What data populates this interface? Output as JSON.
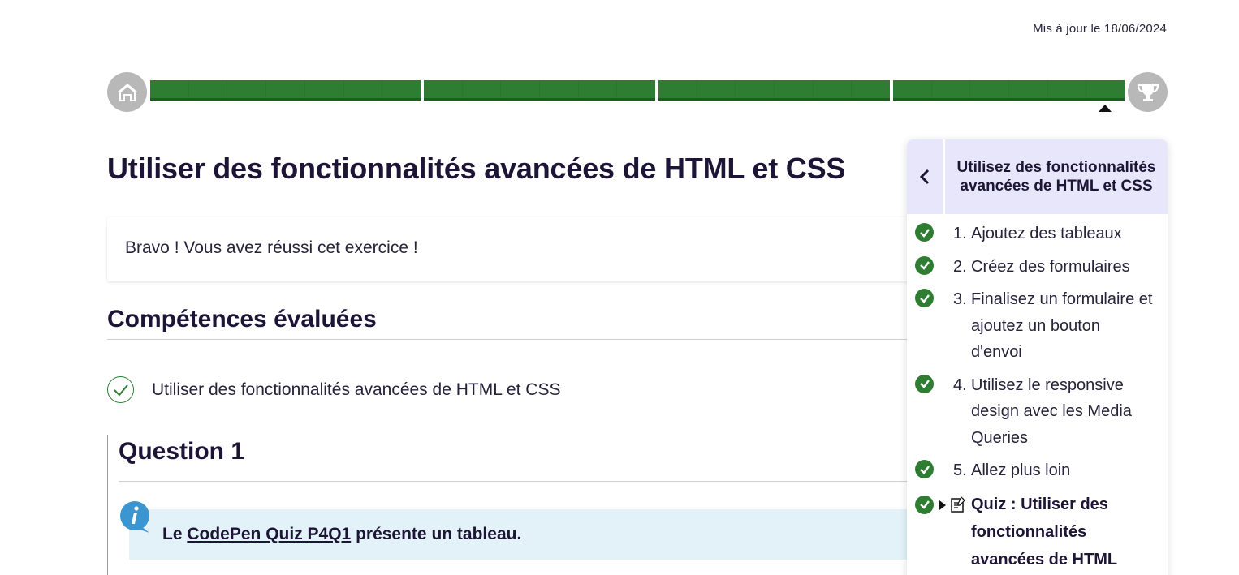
{
  "updated": "Mis à jour le 18/06/2024",
  "progress": {
    "segments": [
      7,
      6,
      6,
      6
    ],
    "marker_position": 0.97,
    "fill_color": "#2e7d32"
  },
  "title": "Utiliser des fonctionnalités avancées de HTML et CSS",
  "success_message": "Bravo ! Vous avez réussi cet exercice !",
  "skills": {
    "heading": "Compétences évaluées",
    "items": [
      "Utiliser des fonctionnalités avancées de HTML et CSS"
    ]
  },
  "question": {
    "heading": "Question 1",
    "info_prefix": "Le ",
    "info_link": "CodePen Quiz P4Q1",
    "info_suffix": " présente un tableau."
  },
  "sidebar": {
    "title": "Utilisez des fonctionnalités avancées de HTML et CSS",
    "items": [
      {
        "num": "1.",
        "label": "Ajoutez des tableaux"
      },
      {
        "num": "2.",
        "label": "Créez des formulaires"
      },
      {
        "num": "3.",
        "label": "Finalisez un formulaire et ajoutez un bouton d'envoi"
      },
      {
        "num": "4.",
        "label": "Utilisez le responsive design avec les Media Queries"
      },
      {
        "num": "5.",
        "label": "Allez plus loin"
      }
    ],
    "current": "Quiz : Utiliser des fonctionnalités avancées de HTML"
  },
  "colors": {
    "accent_green": "#2e7d32",
    "sidebar_header": "#e8e6fb",
    "info_bg": "#e3f2f9",
    "text": "#1d1535"
  },
  "icons": [
    "home-icon",
    "trophy-icon",
    "check-circle-icon",
    "info-icon",
    "chevron-left-icon",
    "quiz-icon"
  ]
}
